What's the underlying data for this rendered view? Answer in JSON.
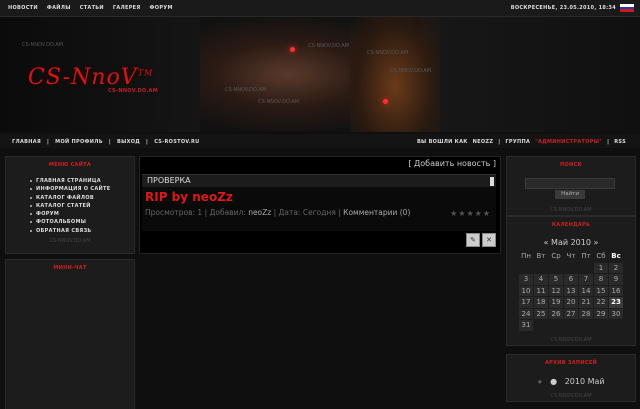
{
  "topbar": {
    "nav": [
      "Новости",
      "Файлы",
      "Статьи",
      "Галерея",
      "Форум"
    ],
    "datetime": "Воскресенье, 23.05.2010, 18:34",
    "flag_colors": [
      "#ffffff",
      "#1a3fb5",
      "#d01818"
    ]
  },
  "header": {
    "logo": "CS-NnoV",
    "logo_sup": "TM",
    "logo_sub": "cs-nnov.do.am",
    "watermarks": [
      "CS-NNOV.DO.AM",
      "CS-NNOV.DO.AM",
      "CS-NNOV.DO.AM",
      "CS-NNOV.DO.AM",
      "CS-NNOV.DO.AM",
      "CS-NNOV.DO.AM"
    ]
  },
  "nav": {
    "left": [
      "Главная",
      "Мой профиль",
      "Выход",
      "CS-Rostov.Ru"
    ],
    "welcome": "Вы вошли как",
    "user": "neoZz",
    "group_label": "Группа",
    "group": "\"Администраторы\"",
    "rss": "RSS"
  },
  "left": {
    "menu_title": "Меню сайта",
    "menu": [
      "Главная страница",
      "Информация о сайте",
      "Каталог файлов",
      "Каталог статей",
      "Форум",
      "Фотоальбомы",
      "Обратная связь"
    ],
    "menu_footer": "CS-NNOV.DO.AM",
    "chat_title": "Мини-чат"
  },
  "center": {
    "add_news": "[ Добавить новость ]",
    "entry": {
      "category": "ПРОВЕРКА",
      "title": "RIP by neoZz",
      "views_label": "Просмотров:",
      "views": "1",
      "added_label": "Добавил:",
      "author": "neoZz",
      "date_label": "Дата:",
      "date": "Сегодня",
      "comments": "Комментарии (0)"
    }
  },
  "right": {
    "search_title": "Поиск",
    "search_button": "Найти",
    "search_footer": "CS-NNOV.DO.AM",
    "calendar_title": "Календарь",
    "calendar_prev": "«",
    "calendar_month": "Май 2010",
    "calendar_next": "»",
    "weekdays": [
      "Пн",
      "Вт",
      "Ср",
      "Чт",
      "Пт",
      "Сб",
      "Вс"
    ],
    "weeks": [
      [
        "",
        "",
        "",
        "",
        "",
        "1",
        "2"
      ],
      [
        "3",
        "4",
        "5",
        "6",
        "7",
        "8",
        "9"
      ],
      [
        "10",
        "11",
        "12",
        "13",
        "14",
        "15",
        "16"
      ],
      [
        "17",
        "18",
        "19",
        "20",
        "21",
        "22",
        "23"
      ],
      [
        "24",
        "25",
        "26",
        "27",
        "28",
        "29",
        "30"
      ],
      [
        "31",
        "",
        "",
        "",
        "",
        "",
        ""
      ]
    ],
    "calendar_footer": "CS-NNOV.DO.AM",
    "archive_title": "Архив записей",
    "archive_entry": "2010 Май",
    "archive_footer": "CS-NNOV.DO.AM"
  }
}
